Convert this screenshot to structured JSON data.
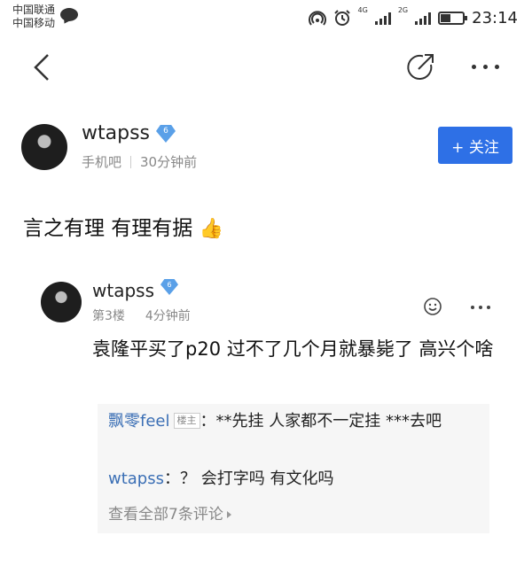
{
  "status_bar": {
    "carrier_1": "中国联通",
    "carrier_2": "中国移动",
    "net_1": "4G",
    "net_2": "2G",
    "time": "23:14"
  },
  "nav": {
    "back_icon": "chevron-left-icon",
    "share_icon": "share-icon",
    "more_icon": "more-horizontal-icon"
  },
  "post": {
    "username": "wtapss",
    "level": "6",
    "source": "手机吧",
    "time": "30分钟前",
    "follow_label": "+ 关注",
    "content": "言之有理 有理有据",
    "emoji": "👍"
  },
  "reply": {
    "username": "wtapss",
    "level": "6",
    "floor": "第3楼",
    "time": "4分钟前",
    "content": "袁隆平买了p20 过不了几个月就暴毙了 高兴个啥",
    "sub_comments": [
      {
        "author": "飘零feel",
        "badge": "楼主",
        "sep": "：",
        "text": "**先挂 人家都不一定挂 ***去吧"
      },
      {
        "author": "wtapss",
        "sep": "：",
        "text": "？ 会打字吗 有文化吗"
      }
    ],
    "view_all": "查看全部7条评论"
  },
  "colors": {
    "accent": "#2e70e6",
    "link": "#3b6fb5",
    "badge": "#5aa0e8"
  }
}
